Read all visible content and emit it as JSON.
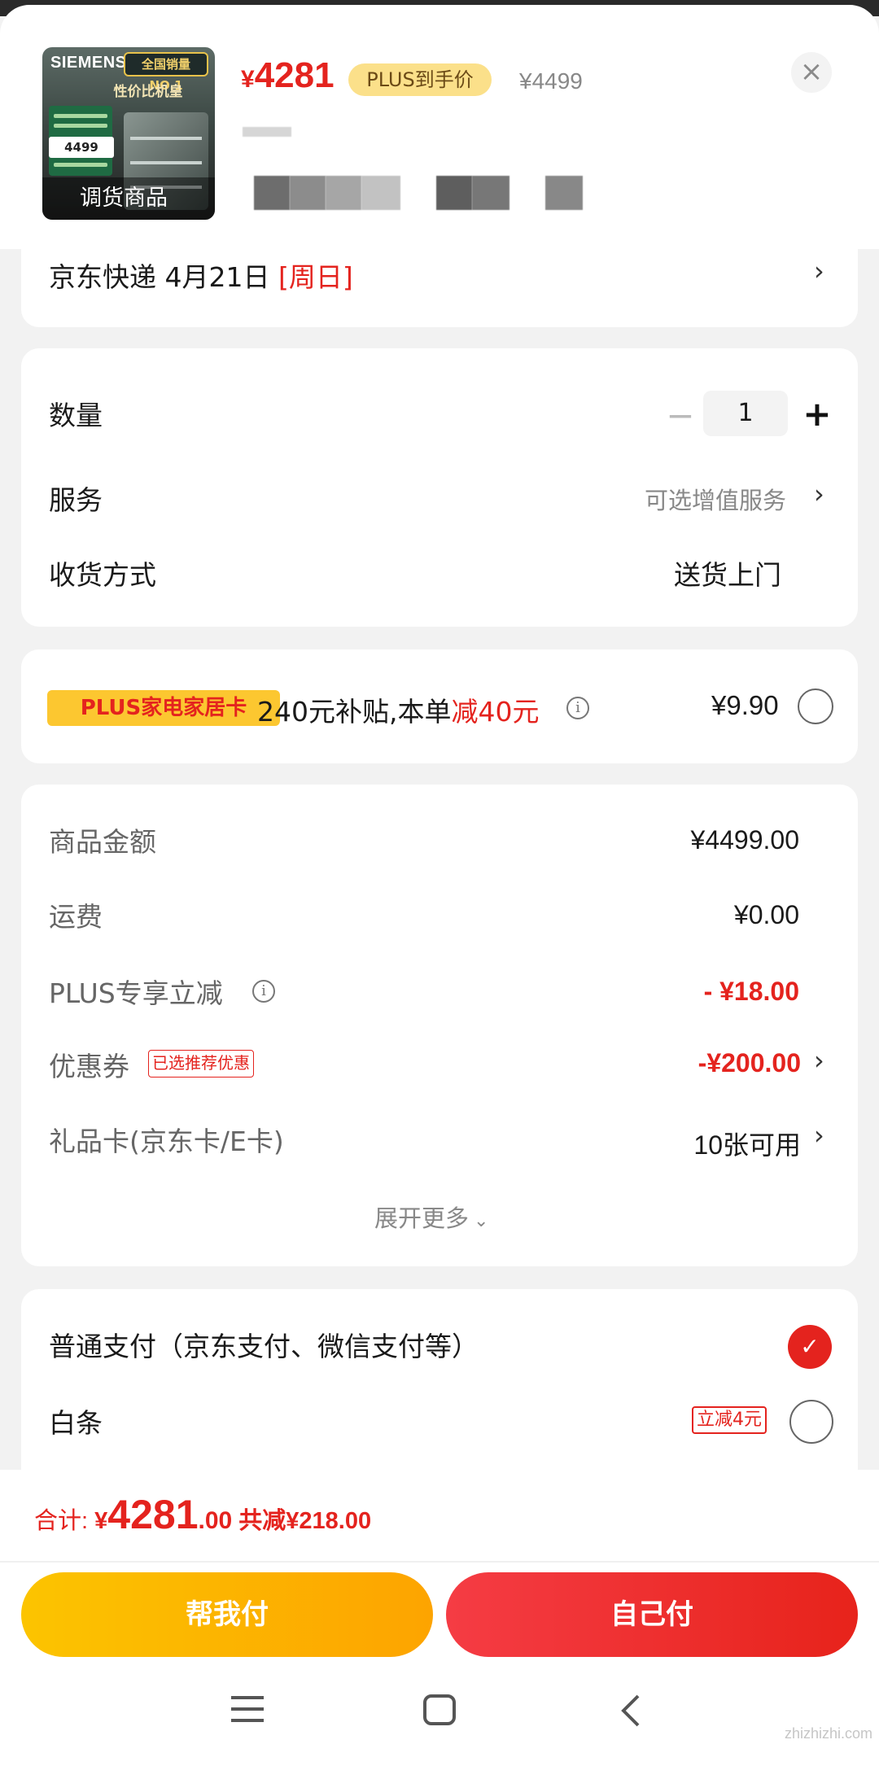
{
  "product": {
    "brand": "SIEMENS",
    "top_badge": "全国销量NO.1",
    "subtitle": "性价比机皇",
    "box_price": "4499",
    "overlay_label": "调货商品",
    "price_symbol": "¥",
    "price": "4281",
    "plus_tag": "PLUS到手价",
    "original_price": "¥4499",
    "close_icon": "close-icon"
  },
  "delivery": {
    "label": "京东快递 4月21日 ",
    "day": "[周日]"
  },
  "options": {
    "quantity_label": "数量",
    "quantity_value": "1",
    "service_label": "服务",
    "service_value": "可选增值服务",
    "shipping_label": "收货方式",
    "shipping_value": "送货上门"
  },
  "plus_card": {
    "tag": "PLUS家电家居卡",
    "text_prefix": "240元补贴,本单",
    "text_highlight": "减40元",
    "price": "¥9.90"
  },
  "summary": {
    "rows": [
      {
        "label": "商品金额",
        "value": "¥4499.00"
      },
      {
        "label": "运费",
        "value": "¥0.00"
      },
      {
        "label": "PLUS专享立减",
        "value": "- ¥18.00"
      },
      {
        "label": "优惠券",
        "tag": "已选推荐优惠",
        "value": "-¥200.00"
      },
      {
        "label": "礼品卡(京东卡/E卡)",
        "value": "10张可用"
      }
    ],
    "expand": "展开更多"
  },
  "payment": {
    "option1": "普通支付（京东支付、微信支付等）",
    "option2": "白条",
    "option2_tag": "立减4元"
  },
  "footer": {
    "total_label": "合计: ",
    "total_symbol": "¥",
    "total_int": "4281",
    "total_dec": ".00",
    "saved": " 共减¥218.00",
    "help_pay": "帮我付",
    "self_pay": "自己付"
  },
  "watermark": "zhizhizhi.com",
  "colors": {
    "accent_red": "#e4231e",
    "plus_yellow": "#fcc730",
    "button_yellow": "#fcc400"
  }
}
